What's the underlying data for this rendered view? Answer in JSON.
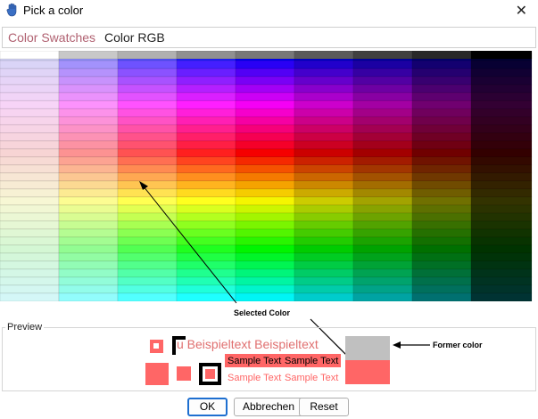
{
  "window": {
    "title": "Pick a color",
    "close_label": "✕"
  },
  "tabs": [
    {
      "label": "Color Swatches",
      "active": true
    },
    {
      "label": "Color RGB",
      "active": false
    }
  ],
  "callouts": {
    "selected": "Selected Color",
    "former": "Former color"
  },
  "preview": {
    "label": "Preview",
    "big_text": "u Beispieltext Beispieltext",
    "sample_text_1": "Sample Text",
    "sample_text_2": "Sample Text",
    "sample_text_3": "Sample Text",
    "sample_text_4": "Sample Text",
    "selected_color": "#ff6666",
    "former_color": "#c0c0c0"
  },
  "buttons": {
    "ok": "OK",
    "cancel": "Abbrechen",
    "reset": "Reset"
  },
  "colors": {
    "selected_hex": "#ff6666",
    "former_hex": "#c0c0c0",
    "tab_active": "#b06070"
  }
}
